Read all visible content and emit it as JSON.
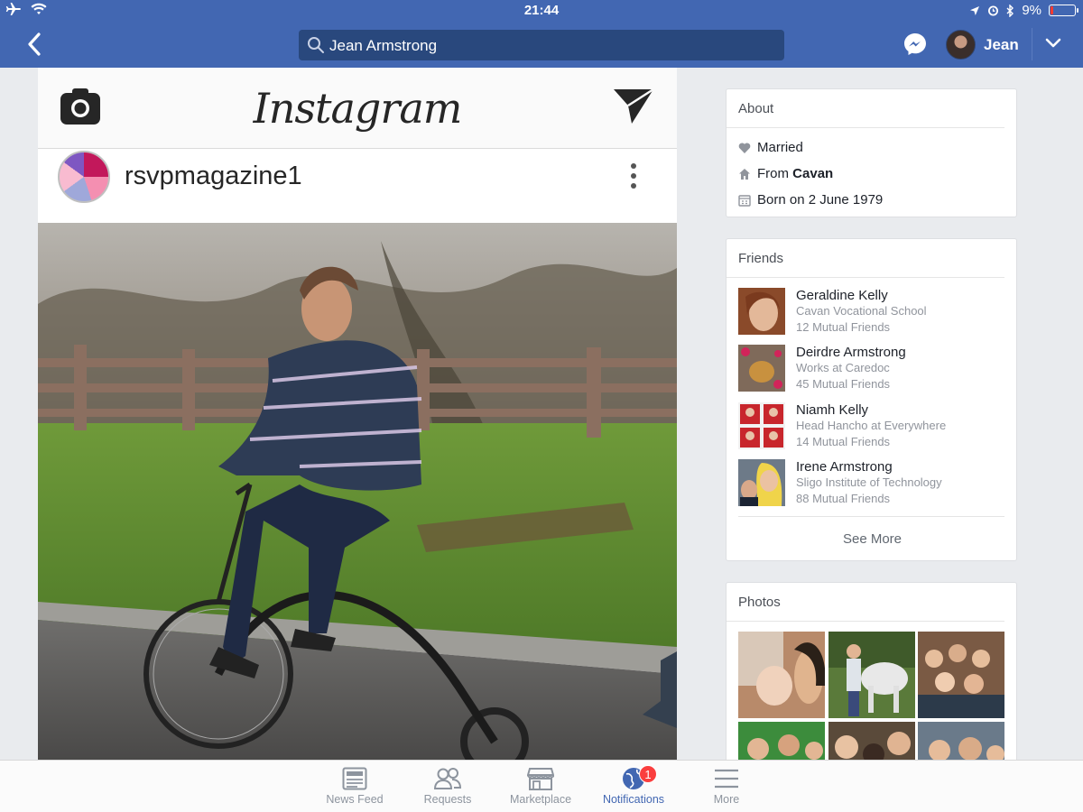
{
  "status_bar": {
    "time": "21:44",
    "battery": "9%"
  },
  "nav": {
    "search_value": "Jean Armstrong",
    "username": "Jean"
  },
  "post": {
    "app_name": "Instagram",
    "account": "rsvpmagazine1"
  },
  "about": {
    "title": "About",
    "married": "Married",
    "from_prefix": "From",
    "from_place": "Cavan",
    "born": "Born on 2 June 1979"
  },
  "friends": {
    "title": "Friends",
    "items": [
      {
        "name": "Geraldine Kelly",
        "detail": "Cavan Vocational School",
        "mutual": "12 Mutual Friends"
      },
      {
        "name": "Deirdre Armstrong",
        "detail": "Works at Caredoc",
        "mutual": "45 Mutual Friends"
      },
      {
        "name": "Niamh Kelly",
        "detail": "Head Hancho at Everywhere",
        "mutual": "14 Mutual Friends"
      },
      {
        "name": "Irene Armstrong",
        "detail": "Sligo Institute of Technology",
        "mutual": "88 Mutual Friends"
      }
    ],
    "see_more": "See More"
  },
  "photos": {
    "title": "Photos"
  },
  "tabbar": {
    "tabs": [
      {
        "label": "News Feed",
        "icon": "news-feed-icon"
      },
      {
        "label": "Requests",
        "icon": "friends-icon"
      },
      {
        "label": "Marketplace",
        "icon": "shop-icon"
      },
      {
        "label": "Notifications",
        "icon": "globe-icon",
        "badge": "1"
      },
      {
        "label": "More",
        "icon": "menu-icon"
      }
    ]
  },
  "colors": {
    "brand": "#4267b2",
    "badge": "#fa3e3e"
  }
}
